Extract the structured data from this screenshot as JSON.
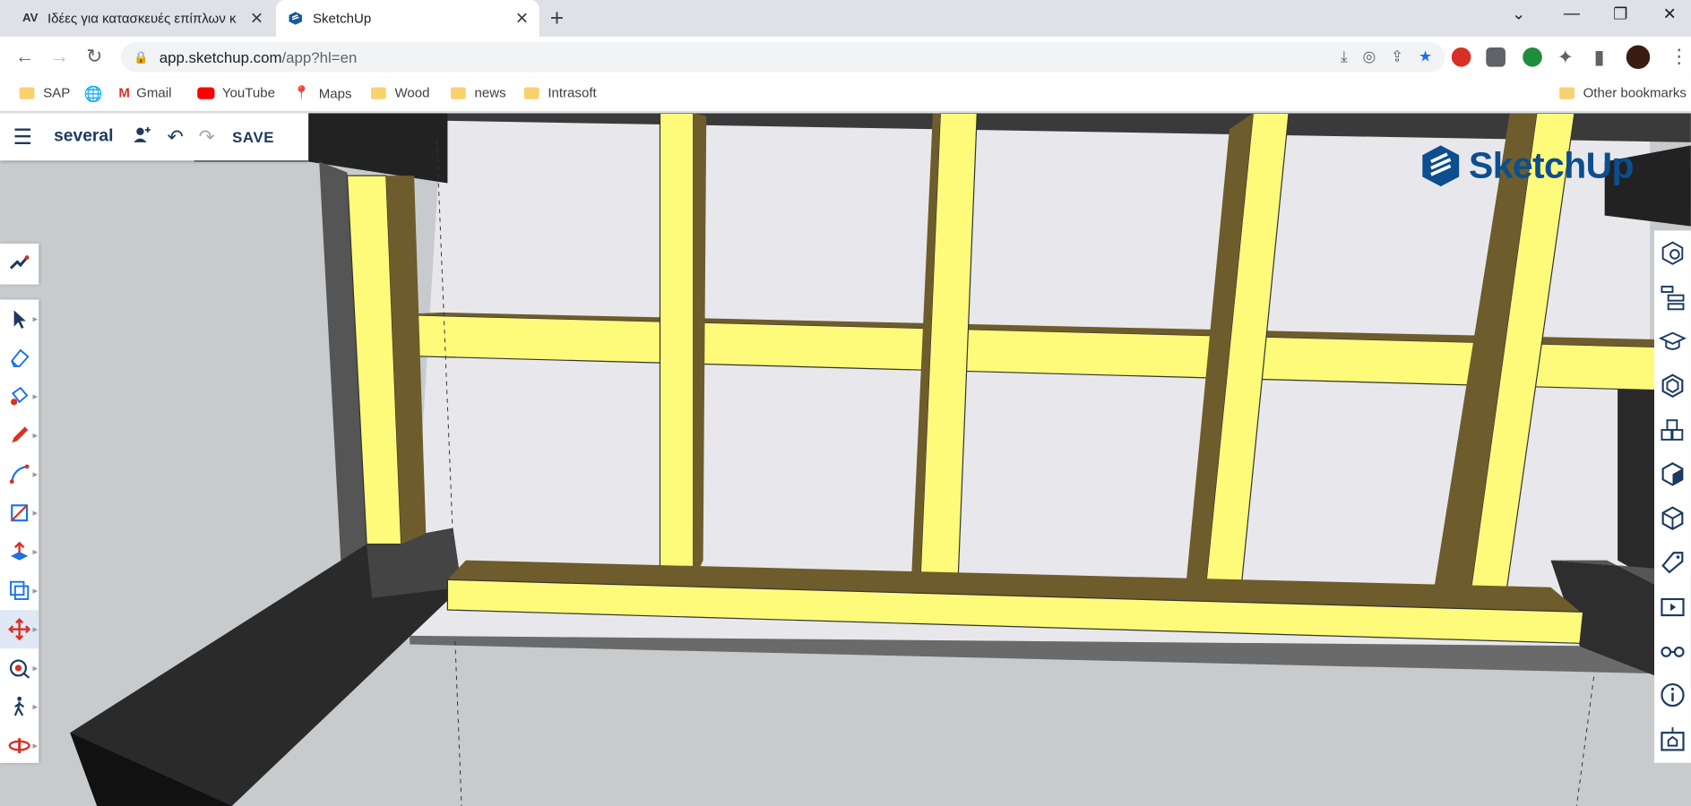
{
  "browser": {
    "tabs": [
      {
        "title": "Ιδέες για κατασκευές επίπλων κ",
        "favicon": "AV",
        "active": false
      },
      {
        "title": "SketchUp",
        "favicon": "sketchup-logo",
        "active": true
      }
    ],
    "new_tab_label": "+",
    "window_controls": [
      "⌄",
      "—",
      "❐",
      "✕"
    ],
    "url_host": "app.sketchup.com",
    "url_path": "/app?hl=en"
  },
  "bookmarks": [
    {
      "label": "SAP",
      "icon": "folder-icon"
    },
    {
      "label": "",
      "icon": "globe-icon"
    },
    {
      "label": "Gmail",
      "icon": "gmail-icon"
    },
    {
      "label": "YouTube",
      "icon": "youtube-icon"
    },
    {
      "label": "Maps",
      "icon": "maps-icon"
    },
    {
      "label": "Wood",
      "icon": "folder-icon"
    },
    {
      "label": "news",
      "icon": "folder-icon"
    },
    {
      "label": "Intrasoft",
      "icon": "folder-icon"
    }
  ],
  "other_bookmarks": "Other bookmarks",
  "sketchup": {
    "document_name": "several",
    "save_label": "SAVE",
    "brand": "SketchUp",
    "left_tools": [
      "search-tool-icon",
      "select-icon",
      "eraser-icon",
      "paint-bucket-icon",
      "pencil-icon",
      "arc-icon",
      "rectangle-icon",
      "push-pull-icon",
      "offset-icon",
      "move-icon",
      "tape-measure-icon",
      "walk-icon",
      "orbit-icon"
    ],
    "right_panels": [
      "entity-info-icon",
      "outliner-icon",
      "instructor-icon",
      "components-icon",
      "materials-icon",
      "styles-icon",
      "views-icon",
      "tags-icon",
      "scenes-icon",
      "display-icon",
      "model-info-icon",
      "extension-icon"
    ]
  },
  "colors": {
    "accent": "#1a73e8",
    "sketchup_blue": "#0c4e8f",
    "wood_face": "#fffb7a",
    "wood_shade": "#6e5c2c",
    "dark_beam": "#2a2a2a"
  }
}
